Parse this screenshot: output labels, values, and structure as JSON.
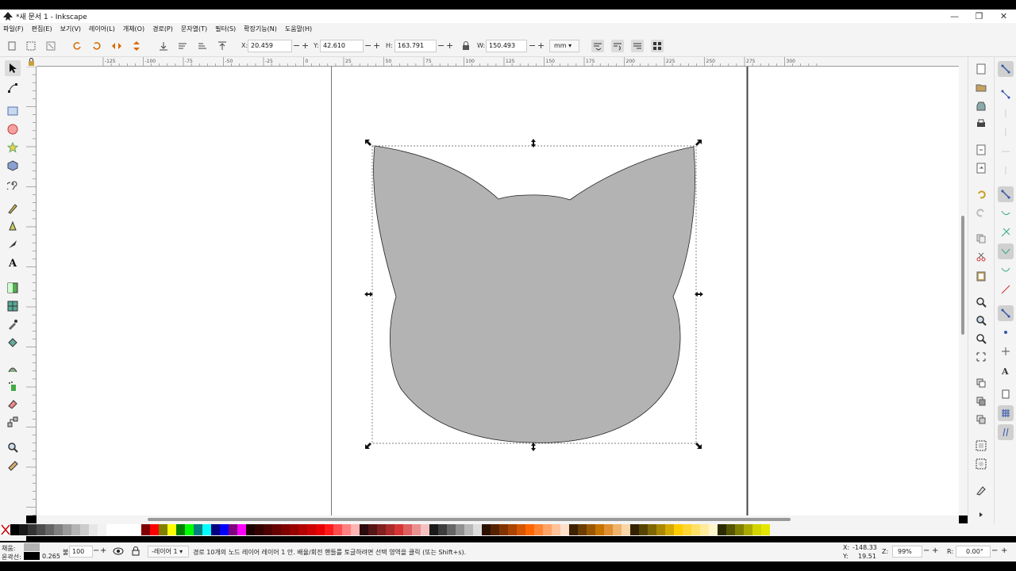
{
  "window": {
    "title": "*새 문서 1 - Inkscape",
    "minimize": "—",
    "maximize": "❐",
    "close": "✕"
  },
  "menu": [
    "파일(F)",
    "편집(E)",
    "보기(V)",
    "레이어(L)",
    "개체(O)",
    "경로(P)",
    "문자열(T)",
    "필터(S)",
    "확장기능(N)",
    "도움말(H)"
  ],
  "toolctl": {
    "x_label": "X:",
    "x_value": "20.459",
    "y_label": "Y:",
    "y_value": "42.610",
    "h_label": "H:",
    "h_value": "163.791",
    "w_label": "W:",
    "w_value": "150.493",
    "unit": "mm",
    "minus": "−",
    "plus": "+"
  },
  "ruler": {
    "h_ticks": [
      "-125",
      "-100",
      "-75",
      "-50",
      "-25",
      "0",
      "25",
      "50",
      "75",
      "100",
      "125",
      "150",
      "175",
      "200",
      "225",
      "250",
      "275",
      "300"
    ]
  },
  "status": {
    "fill_label": "채움:",
    "stroke_label": "윤곽선:",
    "stroke_width": "0.265",
    "opacity_label": "불투명:",
    "opacity": "100",
    "layer": "-레이어 1",
    "message": "경로 10개의 노드 레이어 레이어 1 안. 배율/회전 핸들를 토글하려면 선택 영역을 클릭 (또는 Shift+s).",
    "cursor_x_label": "X:",
    "cursor_x": "-148.33",
    "cursor_y_label": "Y:",
    "cursor_y": "19.51",
    "zoom_label": "Z:",
    "zoom": "99%",
    "rotate_label": "R:",
    "rotate": "0.00°"
  },
  "colors": {
    "shape_fill": "#b3b3b3",
    "palette": [
      "#000000",
      "#1a1a1a",
      "#333333",
      "#4d4d4d",
      "#666666",
      "#808080",
      "#999999",
      "#b3b3b3",
      "#cccccc",
      "#e6e6e6",
      "#f2f2f2",
      "#ffffff",
      "#ffffff",
      "#ffffff",
      "#ffffff",
      "#800000",
      "#ff0000",
      "#808000",
      "#ffff00",
      "#008000",
      "#00ff00",
      "#008080",
      "#00ffff",
      "#000080",
      "#0000ff",
      "#800080",
      "#ff00ff",
      "#1a0000",
      "#330000",
      "#4d0000",
      "#660000",
      "#800000",
      "#990000",
      "#b30000",
      "#cc0000",
      "#e60000",
      "#ff1a1a",
      "#ff4d4d",
      "#ff8080",
      "#ffb3b3",
      "#2b0b0b",
      "#551515",
      "#802020",
      "#aa2b2b",
      "#d53535",
      "#e06060",
      "#ea9090",
      "#f5c0c0",
      "#1a1a1a",
      "#3d3d3d",
      "#666666",
      "#909090",
      "#b8b8b8",
      "#dddddd",
      "#2b1100",
      "#552200",
      "#803300",
      "#aa4400",
      "#d55500",
      "#ff6600",
      "#ff8533",
      "#ffa366",
      "#ffc299",
      "#ffe0cc",
      "#3d2200",
      "#6b3d00",
      "#995800",
      "#c77300",
      "#e08f33",
      "#f0b36b",
      "#f8d6a6",
      "#332200",
      "#554400",
      "#806600",
      "#aa8800",
      "#d4aa00",
      "#ffcc00",
      "#ffd633",
      "#ffe066",
      "#ffeb99",
      "#fff5cc",
      "#2b2b00",
      "#555500",
      "#808000",
      "#aaaa00",
      "#d4d400",
      "#e6e600"
    ]
  },
  "icons": {
    "tools": [
      "selector-arrow-icon",
      "node-tool-icon",
      "rect-tool-icon",
      "ellipse-tool-icon",
      "star-tool-icon",
      "3dbox-tool-icon",
      "spiral-tool-icon",
      "pencil-tool-icon",
      "pen-tool-icon",
      "calligraphy-tool-icon",
      "text-tool-icon",
      "gradient-tool-icon",
      "mesh-tool-icon",
      "dropper-tool-icon",
      "paint-bucket-icon",
      "tweak-tool-icon",
      "spray-tool-icon",
      "eraser-tool-icon",
      "connector-tool-icon",
      "zoom-tool-icon",
      "measure-tool-icon"
    ]
  }
}
